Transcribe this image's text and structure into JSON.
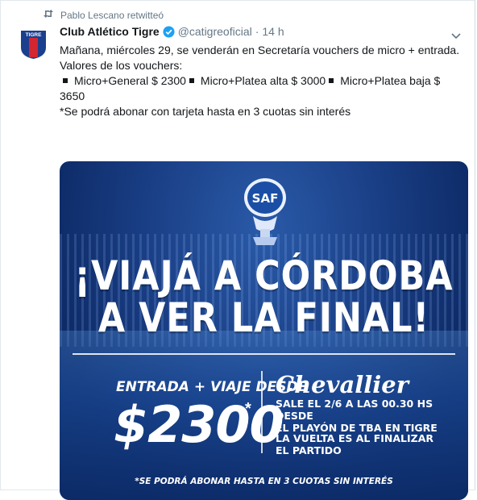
{
  "retweet": {
    "text": "Pablo Lescano retwitteó"
  },
  "tweet": {
    "author_name": "Club Atlético Tigre",
    "handle": "@catigreoficial",
    "separator": "·",
    "time": "14 h",
    "avatar_text": "TIGRE",
    "line1": "Mañana, miércoles 29, se venderán en Secretaría vouchers de micro + entrada.",
    "line2": "Valores de los vouchers:",
    "vouchers": [
      "Micro+General $ 2300",
      "Micro+Platea alta $ 3000",
      "Micro+Platea baja $ 3650"
    ],
    "note": "*Se podrá abonar con tarjeta hasta en 3 cuotas sin interés"
  },
  "media": {
    "logo_text": "SAF",
    "headline_1": "¡VIAJÁ A CÓRDOBA",
    "headline_2": "A VER LA FINAL!",
    "promo_label": "ENTRADA + VIAJE DESDE",
    "price": "$2300",
    "asterisk": "*",
    "company": "Chevallier",
    "detail_1": "SALE EL 2/6 A LAS 00.30 HS DESDE\nEL PLAYÓN  DE TBA EN TIGRE",
    "detail_2": "LA VUELTA ES AL FINALIZAR\nEL PARTIDO",
    "footnote": "*SE PODRÁ ABONAR HASTA EN 3 CUOTAS SIN INTERÉS"
  },
  "colors": {
    "text": "#14171a",
    "muted": "#657786",
    "verified": "#1da1f2",
    "tigre_blue": "#1b3f8f",
    "tigre_red": "#d22630",
    "media_bg": "#123a7c"
  },
  "icons": {
    "retweet": "retweet-icon",
    "verified": "verified-badge-icon",
    "menu": "chevron-down-icon",
    "logo": "trophy-logo-icon"
  }
}
